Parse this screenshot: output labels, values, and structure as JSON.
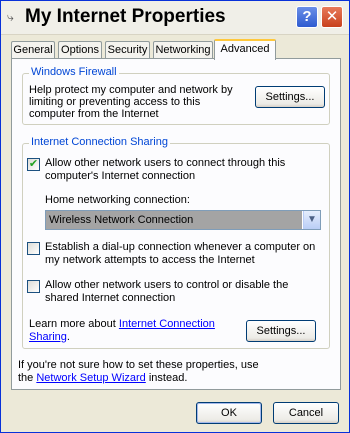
{
  "window": {
    "title": "My Internet Properties",
    "help_button": "?",
    "close_button": "✕"
  },
  "tabs": [
    {
      "label": "General"
    },
    {
      "label": "Options"
    },
    {
      "label": "Security"
    },
    {
      "label": "Networking"
    },
    {
      "label": "Advanced"
    }
  ],
  "firewall": {
    "title": "Windows Firewall",
    "description_line1": "Help protect my computer and network by",
    "description_line2": "limiting or preventing access to this",
    "description_line3": "computer from the Internet",
    "settings_button": "Settings..."
  },
  "ics": {
    "title": "Internet Connection Sharing",
    "allow_sharing_line1": "Allow other network users to connect through this",
    "allow_sharing_line2": "computer's Internet connection",
    "allow_sharing_checked": true,
    "home_connection_label": "Home networking connection:",
    "home_connection_value": "Wireless Network Connection",
    "dialup_line1": "Establish a dial-up connection whenever a computer on",
    "dialup_line2": "my network attempts to access the Internet",
    "dialup_checked": false,
    "allow_control_line1": "Allow other network users to control or disable the",
    "allow_control_line2": "shared Internet connection",
    "allow_control_checked": false,
    "learn_more_prefix": "Learn more about ",
    "learn_more_link_line1": "Internet Connection",
    "learn_more_link_line2": "Sharing",
    "learn_more_suffix": ".",
    "settings_button": "Settings..."
  },
  "footer": {
    "help_line1": "If you're not sure how to set these properties, use",
    "help_prefix": "the ",
    "wizard_link": "Network Setup Wizard",
    "help_suffix": " instead.",
    "ok_button": "OK",
    "cancel_button": "Cancel"
  },
  "colors": {
    "group_title": "#0046D5",
    "window_bg": "#ECE9D8",
    "panel_bg": "#FCFCFE",
    "link": "#0000FF"
  }
}
